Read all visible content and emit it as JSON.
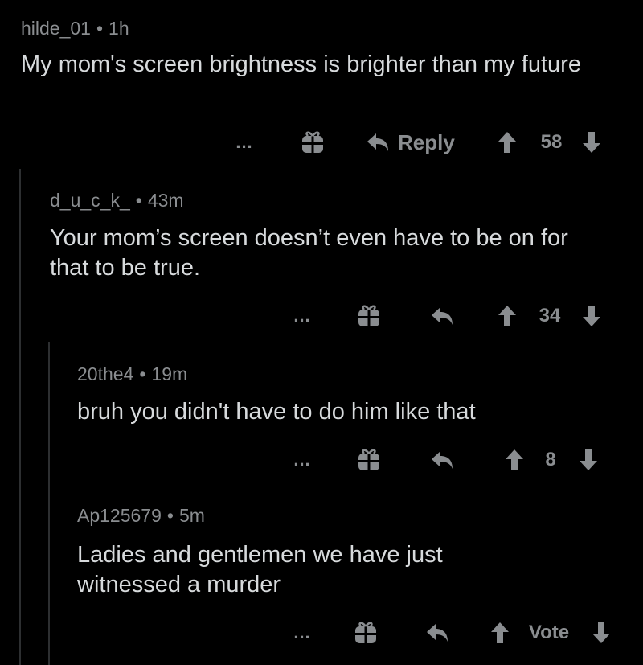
{
  "comments": [
    {
      "username": "hilde_01",
      "age": "1h",
      "text": "My mom's screen brightness is brighter than my future",
      "more": "...",
      "reply_label": "Reply",
      "score": "58"
    },
    {
      "username": "d_u_c_k_",
      "age": "43m",
      "text": "Your mom’s screen doesn’t even have to be on for that to be true.",
      "more": "...",
      "reply_label": "",
      "score": "34"
    },
    {
      "username": "20the4",
      "age": "19m",
      "text": "bruh you didn't have to do him like that",
      "more": "...",
      "reply_label": "",
      "score": "8"
    },
    {
      "username": "Ap125679",
      "age": "5m",
      "text": "Ladies and gentlemen we have just witnessed a murder",
      "more": "...",
      "reply_label": "",
      "score": "Vote"
    }
  ],
  "separator": "•",
  "icons": {
    "more": "more-icon",
    "award": "gift-award-icon",
    "reply": "reply-arrow-icon",
    "upvote": "upvote-arrow-icon",
    "downvote": "downvote-arrow-icon"
  },
  "colors": {
    "background": "#000000",
    "text": "#d7dadc",
    "meta": "#8a8d90",
    "thread_line": "#2d2f31"
  }
}
